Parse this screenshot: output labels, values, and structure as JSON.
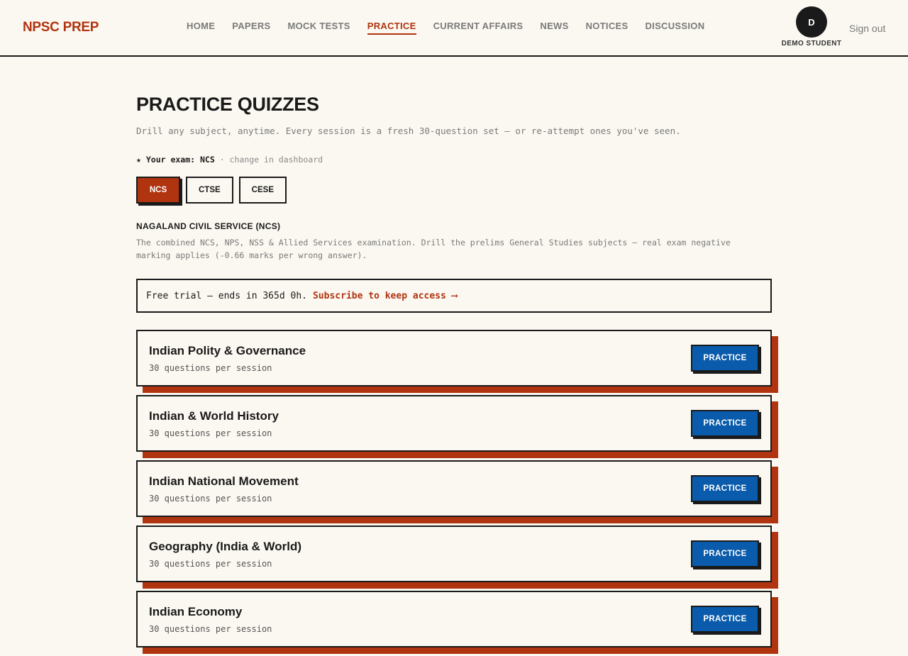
{
  "header": {
    "logo": "NPSC PREP",
    "nav": [
      {
        "label": "HOME",
        "active": false
      },
      {
        "label": "PAPERS",
        "active": false
      },
      {
        "label": "MOCK TESTS",
        "active": false
      },
      {
        "label": "PRACTICE",
        "active": true
      },
      {
        "label": "CURRENT AFFAIRS",
        "active": false
      },
      {
        "label": "NEWS",
        "active": false
      },
      {
        "label": "NOTICES",
        "active": false
      },
      {
        "label": "DISCUSSION",
        "active": false
      }
    ],
    "avatar_initial": "D",
    "user_name": "DEMO STUDENT",
    "signout": "Sign out"
  },
  "page": {
    "title": "PRACTICE QUIZZES",
    "subtitle": "Drill any subject, anytime. Every session is a fresh 30-question set — or re-attempt ones you've seen.",
    "exam_prefix": "★ Your exam: NCS",
    "exam_hint": " · change in dashboard",
    "exam_tabs": [
      {
        "label": "NCS",
        "active": true
      },
      {
        "label": "CTSE",
        "active": false
      },
      {
        "label": "CESE",
        "active": false
      }
    ],
    "exam_heading": "NAGALAND CIVIL SERVICE (NCS)",
    "exam_description": "The combined NCS, NPS, NSS & Allied Services examination. Drill the prelims General Studies subjects — real exam negative marking applies (-0.66 marks per wrong answer).",
    "trial_text": "Free trial — ends in 365d 0h.",
    "trial_link": "Subscribe to keep access ⟶",
    "quizzes": [
      {
        "title": "Indian Polity & Governance",
        "meta": "30 questions per session",
        "button": "PRACTICE"
      },
      {
        "title": "Indian & World History",
        "meta": "30 questions per session",
        "button": "PRACTICE"
      },
      {
        "title": "Indian National Movement",
        "meta": "30 questions per session",
        "button": "PRACTICE"
      },
      {
        "title": "Geography (India & World)",
        "meta": "30 questions per session",
        "button": "PRACTICE"
      },
      {
        "title": "Indian Economy",
        "meta": "30 questions per session",
        "button": "PRACTICE"
      }
    ]
  },
  "colors": {
    "background": "#fbf8f1",
    "accent": "#b03410",
    "button_blue": "#0a5bab",
    "ink": "#1a1a1a"
  }
}
